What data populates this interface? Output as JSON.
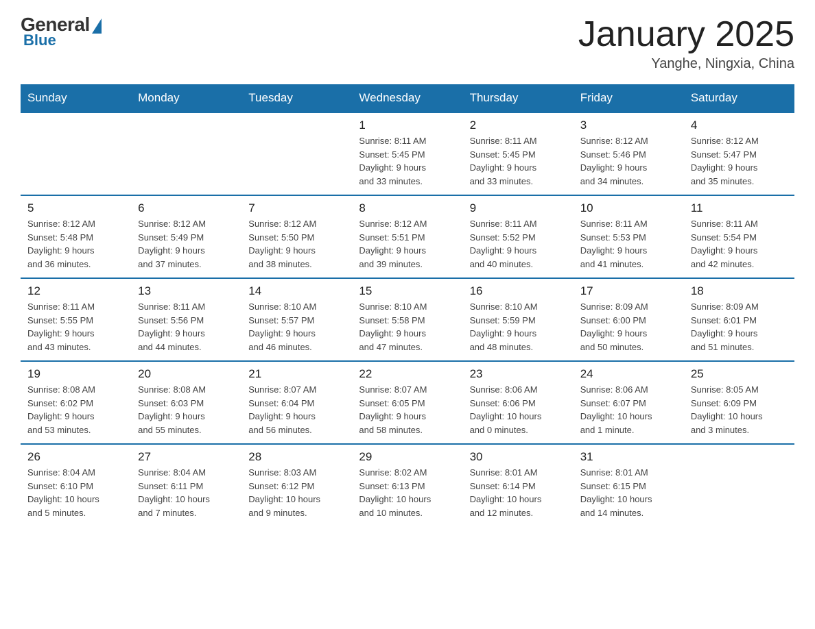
{
  "logo": {
    "general": "General",
    "blue": "Blue"
  },
  "header": {
    "month": "January 2025",
    "location": "Yanghe, Ningxia, China"
  },
  "weekdays": [
    "Sunday",
    "Monday",
    "Tuesday",
    "Wednesday",
    "Thursday",
    "Friday",
    "Saturday"
  ],
  "weeks": [
    [
      {
        "day": "",
        "info": ""
      },
      {
        "day": "",
        "info": ""
      },
      {
        "day": "",
        "info": ""
      },
      {
        "day": "1",
        "info": "Sunrise: 8:11 AM\nSunset: 5:45 PM\nDaylight: 9 hours\nand 33 minutes."
      },
      {
        "day": "2",
        "info": "Sunrise: 8:11 AM\nSunset: 5:45 PM\nDaylight: 9 hours\nand 33 minutes."
      },
      {
        "day": "3",
        "info": "Sunrise: 8:12 AM\nSunset: 5:46 PM\nDaylight: 9 hours\nand 34 minutes."
      },
      {
        "day": "4",
        "info": "Sunrise: 8:12 AM\nSunset: 5:47 PM\nDaylight: 9 hours\nand 35 minutes."
      }
    ],
    [
      {
        "day": "5",
        "info": "Sunrise: 8:12 AM\nSunset: 5:48 PM\nDaylight: 9 hours\nand 36 minutes."
      },
      {
        "day": "6",
        "info": "Sunrise: 8:12 AM\nSunset: 5:49 PM\nDaylight: 9 hours\nand 37 minutes."
      },
      {
        "day": "7",
        "info": "Sunrise: 8:12 AM\nSunset: 5:50 PM\nDaylight: 9 hours\nand 38 minutes."
      },
      {
        "day": "8",
        "info": "Sunrise: 8:12 AM\nSunset: 5:51 PM\nDaylight: 9 hours\nand 39 minutes."
      },
      {
        "day": "9",
        "info": "Sunrise: 8:11 AM\nSunset: 5:52 PM\nDaylight: 9 hours\nand 40 minutes."
      },
      {
        "day": "10",
        "info": "Sunrise: 8:11 AM\nSunset: 5:53 PM\nDaylight: 9 hours\nand 41 minutes."
      },
      {
        "day": "11",
        "info": "Sunrise: 8:11 AM\nSunset: 5:54 PM\nDaylight: 9 hours\nand 42 minutes."
      }
    ],
    [
      {
        "day": "12",
        "info": "Sunrise: 8:11 AM\nSunset: 5:55 PM\nDaylight: 9 hours\nand 43 minutes."
      },
      {
        "day": "13",
        "info": "Sunrise: 8:11 AM\nSunset: 5:56 PM\nDaylight: 9 hours\nand 44 minutes."
      },
      {
        "day": "14",
        "info": "Sunrise: 8:10 AM\nSunset: 5:57 PM\nDaylight: 9 hours\nand 46 minutes."
      },
      {
        "day": "15",
        "info": "Sunrise: 8:10 AM\nSunset: 5:58 PM\nDaylight: 9 hours\nand 47 minutes."
      },
      {
        "day": "16",
        "info": "Sunrise: 8:10 AM\nSunset: 5:59 PM\nDaylight: 9 hours\nand 48 minutes."
      },
      {
        "day": "17",
        "info": "Sunrise: 8:09 AM\nSunset: 6:00 PM\nDaylight: 9 hours\nand 50 minutes."
      },
      {
        "day": "18",
        "info": "Sunrise: 8:09 AM\nSunset: 6:01 PM\nDaylight: 9 hours\nand 51 minutes."
      }
    ],
    [
      {
        "day": "19",
        "info": "Sunrise: 8:08 AM\nSunset: 6:02 PM\nDaylight: 9 hours\nand 53 minutes."
      },
      {
        "day": "20",
        "info": "Sunrise: 8:08 AM\nSunset: 6:03 PM\nDaylight: 9 hours\nand 55 minutes."
      },
      {
        "day": "21",
        "info": "Sunrise: 8:07 AM\nSunset: 6:04 PM\nDaylight: 9 hours\nand 56 minutes."
      },
      {
        "day": "22",
        "info": "Sunrise: 8:07 AM\nSunset: 6:05 PM\nDaylight: 9 hours\nand 58 minutes."
      },
      {
        "day": "23",
        "info": "Sunrise: 8:06 AM\nSunset: 6:06 PM\nDaylight: 10 hours\nand 0 minutes."
      },
      {
        "day": "24",
        "info": "Sunrise: 8:06 AM\nSunset: 6:07 PM\nDaylight: 10 hours\nand 1 minute."
      },
      {
        "day": "25",
        "info": "Sunrise: 8:05 AM\nSunset: 6:09 PM\nDaylight: 10 hours\nand 3 minutes."
      }
    ],
    [
      {
        "day": "26",
        "info": "Sunrise: 8:04 AM\nSunset: 6:10 PM\nDaylight: 10 hours\nand 5 minutes."
      },
      {
        "day": "27",
        "info": "Sunrise: 8:04 AM\nSunset: 6:11 PM\nDaylight: 10 hours\nand 7 minutes."
      },
      {
        "day": "28",
        "info": "Sunrise: 8:03 AM\nSunset: 6:12 PM\nDaylight: 10 hours\nand 9 minutes."
      },
      {
        "day": "29",
        "info": "Sunrise: 8:02 AM\nSunset: 6:13 PM\nDaylight: 10 hours\nand 10 minutes."
      },
      {
        "day": "30",
        "info": "Sunrise: 8:01 AM\nSunset: 6:14 PM\nDaylight: 10 hours\nand 12 minutes."
      },
      {
        "day": "31",
        "info": "Sunrise: 8:01 AM\nSunset: 6:15 PM\nDaylight: 10 hours\nand 14 minutes."
      },
      {
        "day": "",
        "info": ""
      }
    ]
  ]
}
